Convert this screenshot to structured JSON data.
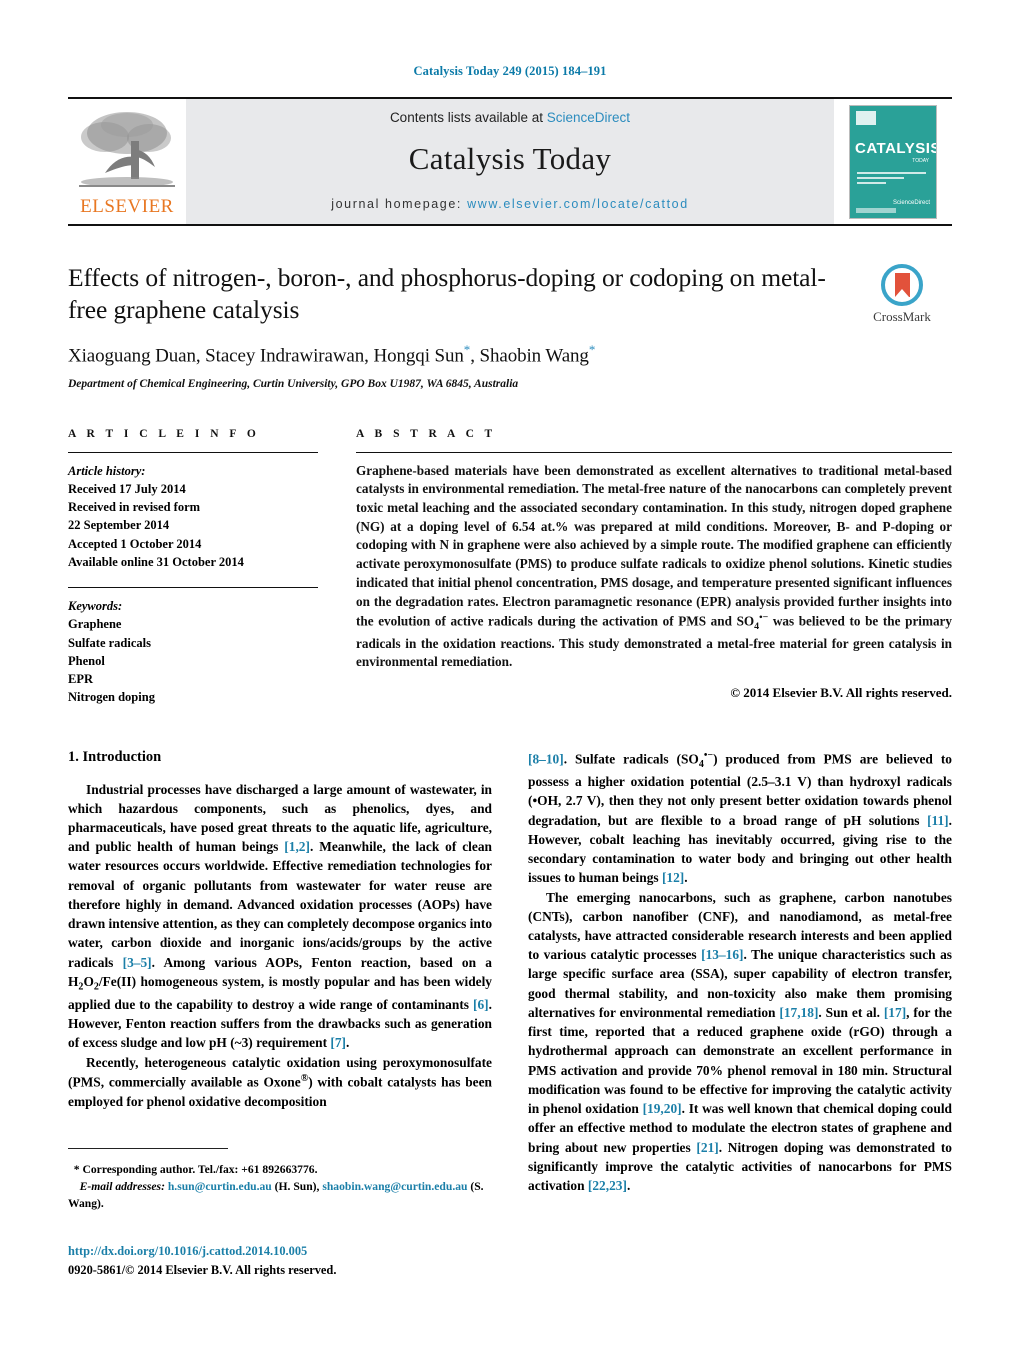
{
  "running_head": "Catalysis Today 249 (2015) 184–191",
  "masthead": {
    "contents_prefix": "Contents lists available at ",
    "sciencedirect": "ScienceDirect",
    "journal_name": "Catalysis Today",
    "homepage_label": "journal homepage:",
    "homepage_url": "www.elsevier.com/locate/cattod",
    "publisher_logo_text": "ELSEVIER",
    "cover_title": "CATALYSIS",
    "cover_subtitle": "TODAY",
    "cover_sciencedirect": "Available online at\nScienceDirect",
    "accent_link_color": "#2b8cbe",
    "cover_background": "#2aa198",
    "elsevier_orange": "#E87722"
  },
  "article": {
    "title": "Effects of nitrogen-, boron-, and phosphorus-doping or codoping on metal-free graphene catalysis",
    "authors": "Xiaoguang Duan, Stacey Indrawirawan, Hongqi Sun*, Shaobin Wang*",
    "authors_parts": [
      {
        "text": "Xiaoguang Duan, Stacey Indrawirawan, Hongqi Sun",
        "sup": "*"
      },
      {
        "text": ", Shaobin Wang",
        "sup": "*"
      }
    ],
    "affiliation": "Department of Chemical Engineering, Curtin University, GPO Box U1987, WA 6845, Australia",
    "crossmark_label": "CrossMark"
  },
  "article_info": {
    "heading": "A R T I C L E   I N F O",
    "history_label": "Article history:",
    "history": [
      "Received 17 July 2014",
      "Received in revised form",
      "22 September 2014",
      "Accepted 1 October 2014",
      "Available online 31 October 2014"
    ],
    "keywords_label": "Keywords:",
    "keywords": [
      "Graphene",
      "Sulfate radicals",
      "Phenol",
      "EPR",
      "Nitrogen doping"
    ]
  },
  "abstract": {
    "heading": "A B S T R A C T",
    "text_part1": "Graphene-based materials have been demonstrated as excellent alternatives to traditional metal-based catalysts in environmental remediation. The metal-free nature of the nanocarbons can completely prevent toxic metal leaching and the associated secondary contamination. In this study, nitrogen doped graphene (NG) at a doping level of 6.54 at.% was prepared at mild conditions. Moreover, B- and P-doping or codoping with N in graphene were also achieved by a simple route. The modified graphene can efficiently activate peroxymonosulfate (PMS) to produce sulfate radicals to oxidize phenol solutions. Kinetic studies indicated that initial phenol concentration, PMS dosage, and temperature presented significant influences on the degradation rates. Electron paramagnetic resonance (EPR) analysis provided further insights into the evolution of active radicals during the activation of PMS and SO",
    "so4_sub": "4",
    "so4_sup": "•−",
    "text_part2": " was believed to be the primary radicals in the oxidation reactions. This study demonstrated a metal-free material for green catalysis in environmental remediation.",
    "copyright": "© 2014 Elsevier B.V. All rights reserved."
  },
  "introduction": {
    "section_number": "1.",
    "section_title": "Introduction",
    "left_p1_a": "Industrial processes have discharged a large amount of wastewater, in which hazardous components, such as phenolics, dyes, and pharmaceuticals, have posed great threats to the aquatic life, agriculture, and public health of human beings ",
    "left_p1_c1": "[1,2]",
    "left_p1_b": ". Meanwhile, the lack of clean water resources occurs worldwide. Effective remediation technologies for removal of organic pollutants from wastewater for water reuse are therefore highly in demand. Advanced oxidation processes (AOPs) have drawn intensive attention, as they can completely decompose organics into water, carbon dioxide and inorganic ions/acids/groups by the active radicals ",
    "left_p1_c2": "[3–5]",
    "left_p1_d": ". Among various AOPs, Fenton reaction, based on a H",
    "left_p1_h2o2_sub1": "2",
    "left_p1_o": "O",
    "left_p1_h2o2_sub2": "2",
    "left_p1_e": "/Fe(II) homogeneous system, is mostly popular and has been widely applied due to the capability to destroy a wide range of contaminants ",
    "left_p1_c3": "[6]",
    "left_p1_f": ". However, Fenton reaction suffers from the drawbacks such as generation of excess sludge and low pH (~3) requirement ",
    "left_p1_c4": "[7]",
    "left_p1_g": ".",
    "left_p2_a": "Recently, heterogeneous catalytic oxidation using peroxymonosulfate (PMS, commercially available as Oxone",
    "left_p2_reg": "®",
    "left_p2_b": ") with cobalt catalysts has been employed for phenol oxidative decomposition",
    "right_p1_c0": "[8–10]",
    "right_p1_a": ". Sulfate radicals (SO",
    "right_p1_sub": "4",
    "right_p1_sup": "•−",
    "right_p1_b": ") produced from PMS are believed to possess a higher oxidation potential (2.5–3.1 V) than hydroxyl radicals (•OH, 2.7 V), then they not only present better oxidation towards phenol degradation, but are flexible to a broad range of pH solutions ",
    "right_p1_c1": "[11]",
    "right_p1_c": ". However, cobalt leaching has inevitably occurred, giving rise to the secondary contamination to water body and bringing out other health issues to human beings ",
    "right_p1_c2": "[12]",
    "right_p1_d": ".",
    "right_p2_a": "The emerging nanocarbons, such as graphene, carbon nanotubes (CNTs), carbon nanofiber (CNF), and nanodiamond, as metal-free catalysts, have attracted considerable research interests and been applied to various catalytic processes ",
    "right_p2_c1": "[13–16]",
    "right_p2_b": ". The unique characteristics such as large specific surface area (SSA), super capability of electron transfer, good thermal stability, and non-toxicity also make them promising alternatives for environmental remediation ",
    "right_p2_c2": "[17,18]",
    "right_p2_c": ". Sun et al. ",
    "right_p2_c3": "[17]",
    "right_p2_d": ", for the first time, reported that a reduced graphene oxide (rGO) through a hydrothermal approach can demonstrate an excellent performance in PMS activation and provide 70% phenol removal in 180 min. Structural modification was found to be effective for improving the catalytic activity in phenol oxidation ",
    "right_p2_c4": "[19,20]",
    "right_p2_e": ". It was well known that chemical doping could offer an effective method to modulate the electron states of graphene and bring about new properties ",
    "right_p2_c5": "[21]",
    "right_p2_f": ". Nitrogen doping was demonstrated to significantly improve the catalytic activities of nanocarbons for PMS activation ",
    "right_p2_c6": "[22,23]",
    "right_p2_g": "."
  },
  "footer": {
    "corresponding_marker": "*",
    "corresponding_text": "Corresponding author. Tel./fax: +61 892663776.",
    "email_label": "E-mail addresses:",
    "email1": "h.sun@curtin.edu.au",
    "email1_owner": "(H. Sun)",
    "email2": "shaobin.wang@curtin.edu.au",
    "email2_owner": "(S. Wang).",
    "doi": "http://dx.doi.org/10.1016/j.cattod.2014.10.005",
    "issn_line": "0920-5861/© 2014 Elsevier B.V. All rights reserved."
  }
}
